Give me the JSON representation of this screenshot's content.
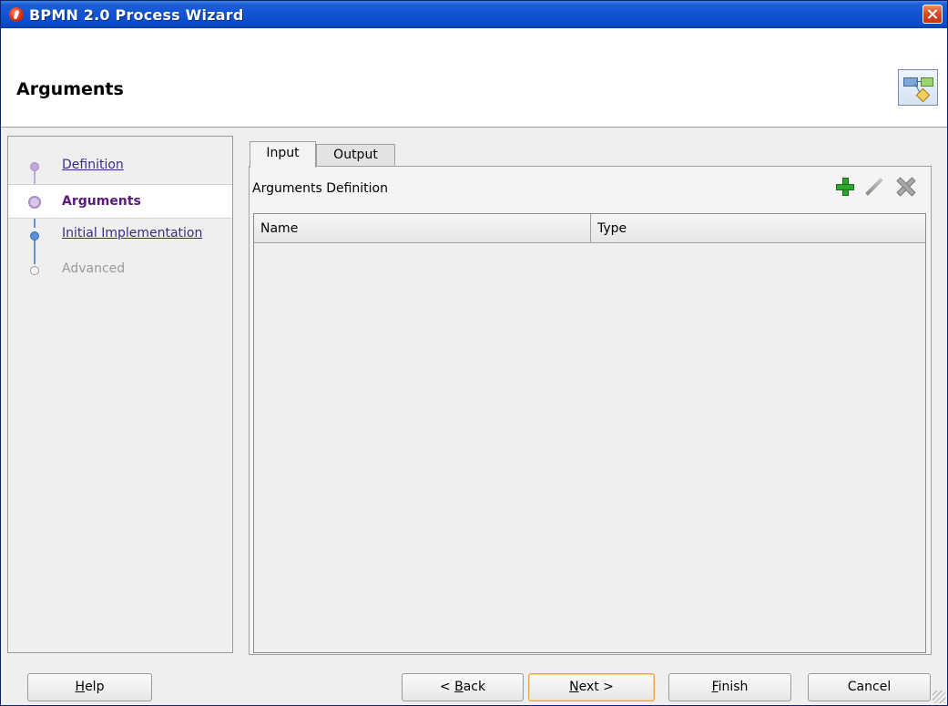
{
  "window": {
    "title": "BPMN 2.0 Process Wizard",
    "icon": "oracle-circle-icon"
  },
  "header": {
    "title": "Arguments",
    "icon": "process-diagram-icon"
  },
  "nav": {
    "items": [
      {
        "label": "Definition",
        "state": "link"
      },
      {
        "label": "Arguments",
        "state": "selected"
      },
      {
        "label": "Initial Implementation",
        "state": "link"
      },
      {
        "label": "Advanced",
        "state": "disabled"
      }
    ]
  },
  "tabs": [
    {
      "label": "Input",
      "active": true
    },
    {
      "label": "Output",
      "active": false
    }
  ],
  "section": {
    "label": "Arguments Definition"
  },
  "toolbar": {
    "icons": [
      "add-icon",
      "edit-icon",
      "delete-icon"
    ]
  },
  "table": {
    "columns": [
      "Name",
      "Type"
    ],
    "rows": []
  },
  "buttons": {
    "help_prefix": "",
    "help_mnemonic": "H",
    "help_rest": "elp",
    "back_prefix": "< ",
    "back_mnemonic": "B",
    "back_rest": "ack",
    "next_prefix": "",
    "next_mnemonic": "N",
    "next_rest": "ext >",
    "finish_prefix": "",
    "finish_mnemonic": "F",
    "finish_rest": "inish",
    "cancel": "Cancel"
  },
  "colors": {
    "titlebar": "#0a49c7",
    "link": "#3d2a84",
    "selected_nav": "#5a1a7a",
    "focus_border": "#e8a53a"
  }
}
